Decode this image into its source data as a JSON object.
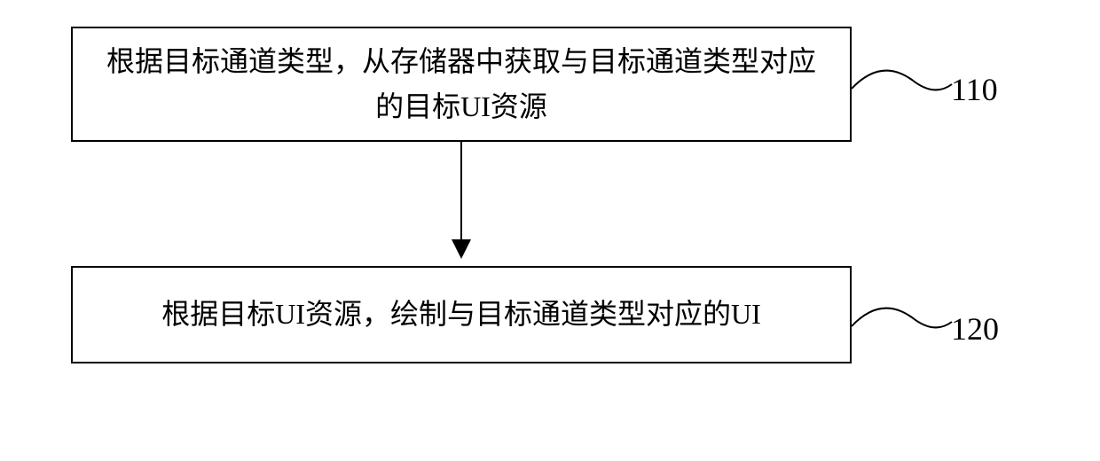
{
  "flow": {
    "step1": {
      "text": "根据目标通道类型，从存储器中获取与目标通道类型对应的目标UI资源",
      "label": "110"
    },
    "step2": {
      "text": "根据目标UI资源，绘制与目标通道类型对应的UI",
      "label": "120"
    }
  }
}
